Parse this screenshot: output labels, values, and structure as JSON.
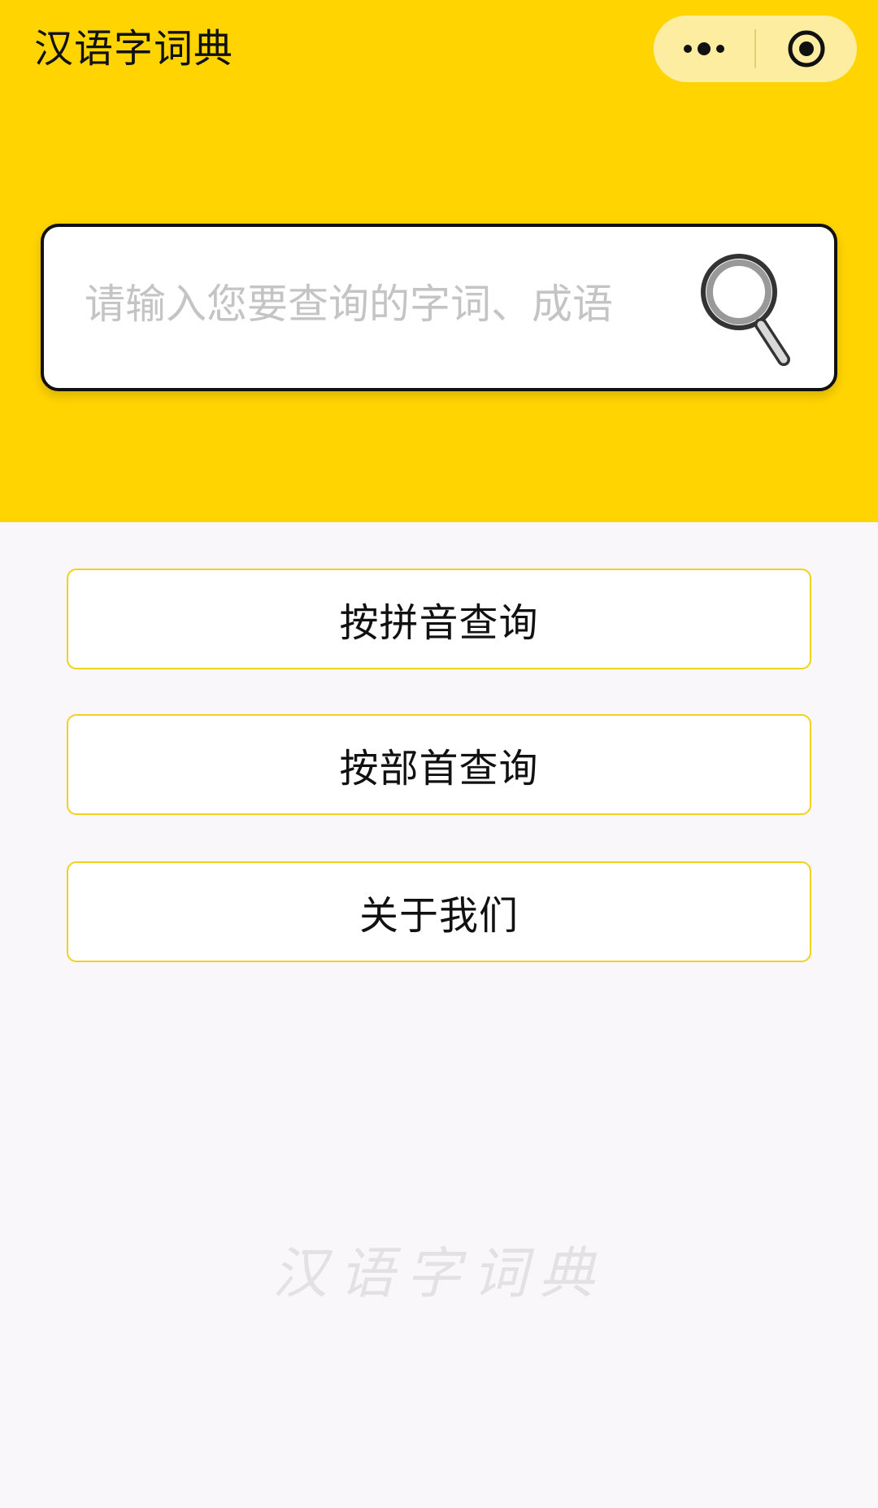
{
  "header": {
    "title": "汉语字词典",
    "background_color": "#ffd400",
    "capsule": {
      "more_icon": "more-dots-icon",
      "close_icon": "target-circle-icon"
    }
  },
  "search": {
    "placeholder": "请输入您要查询的字词、成语",
    "value": "",
    "icon": "magnifier-icon"
  },
  "menu": {
    "pinyin_label": "按拼音查询",
    "radical_label": "按部首查询",
    "about_label": "关于我们",
    "border_color": "#f0d21c"
  },
  "footer": {
    "watermark": "汉语字词典"
  }
}
